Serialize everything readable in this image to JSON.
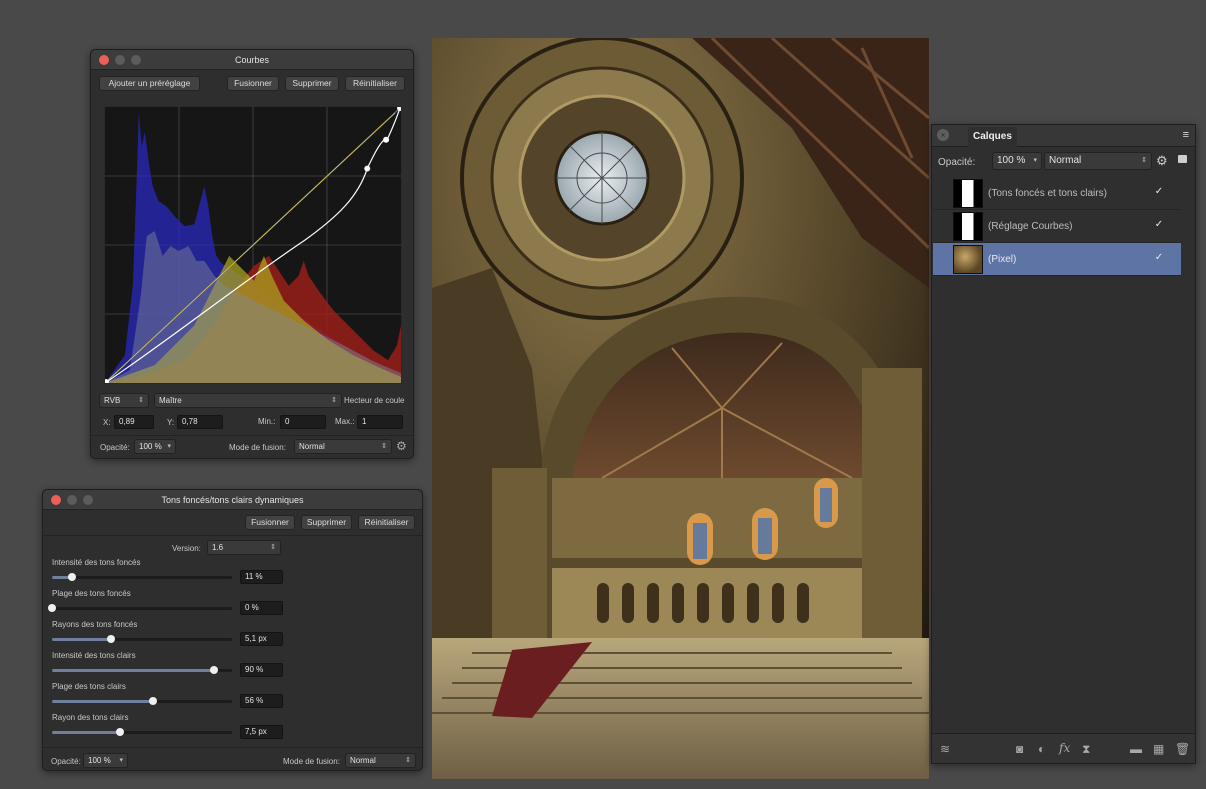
{
  "curves": {
    "title": "Courbes",
    "add_preset": "Ajouter un préréglage",
    "merge": "Fusionner",
    "delete": "Supprimer",
    "reset": "Réinitialiser",
    "channel": "RVB",
    "master": "Maître",
    "picker": "Hecteur de coule",
    "x_label": "X:",
    "x_value": "0,89",
    "y_label": "Y:",
    "y_value": "0,78",
    "min_label": "Min.:",
    "min_value": "0",
    "max_label": "Max.:",
    "max_value": "1",
    "opacity_label": "Opacité:",
    "opacity_value": "100 %",
    "blend_label": "Mode de fusion:",
    "blend_value": "Normal"
  },
  "shadows": {
    "title": "Tons foncés/tons clairs dynamiques",
    "merge": "Fusionner",
    "delete": "Supprimer",
    "reset": "Réinitialiser",
    "version_label": "Version:",
    "version_value": "1.6",
    "sliders": [
      {
        "label": "Intensité des tons foncés",
        "value": "11 %",
        "level": 0.11
      },
      {
        "label": "Plage des tons foncés",
        "value": "0 %",
        "level": 0.0
      },
      {
        "label": "Rayons des tons foncés",
        "value": "5,1 px",
        "level": 0.33
      },
      {
        "label": "Intensité des tons clairs",
        "value": "90 %",
        "level": 0.9
      },
      {
        "label": "Plage des tons clairs",
        "value": "56 %",
        "level": 0.56
      },
      {
        "label": "Rayon des tons clairs",
        "value": "7,5 px",
        "level": 0.38
      }
    ],
    "opacity_label": "Opacité:",
    "opacity_value": "100 %",
    "blend_label": "Mode de fusion:",
    "blend_value": "Normal"
  },
  "layers": {
    "tab": "Calques",
    "opacity_label": "Opacité:",
    "opacity_value": "100 %",
    "blend_value": "Normal",
    "items": [
      {
        "name": "(Tons foncés et tons clairs)",
        "checked": "✓"
      },
      {
        "name": "(Réglage Courbes)",
        "checked": "✓"
      },
      {
        "name": "(Pixel)",
        "checked": "✓"
      }
    ]
  }
}
